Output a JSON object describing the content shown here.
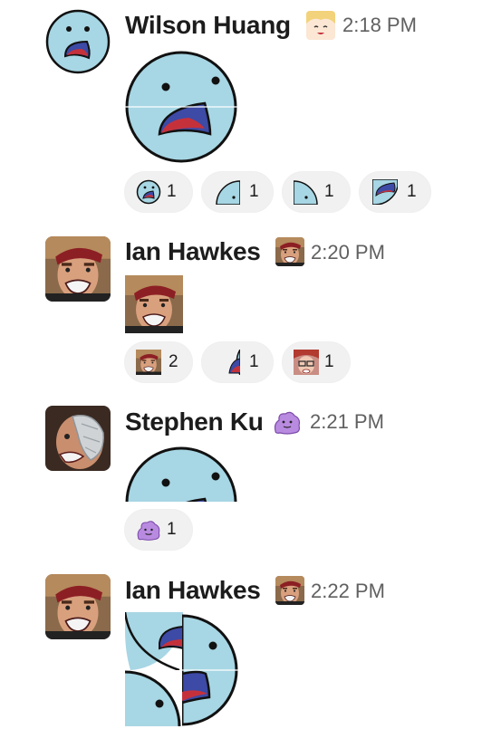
{
  "colors": {
    "face_blue": "#a7d6e4",
    "mouth_navy": "#3d4aa6",
    "tongue_red": "#c5313b",
    "reaction_bg": "#f1f1f1",
    "time_gray": "#616061"
  },
  "messages": [
    {
      "author": "Wilson Huang",
      "badge_icon": "anime-girl-emoji",
      "time": "2:18 PM",
      "attachment": "screaming-blue-face-emoji",
      "reactions": [
        {
          "emoji": "blue-face-emoji",
          "count": "1"
        },
        {
          "emoji": "blue-face-piece-top-left-emoji",
          "count": "1"
        },
        {
          "emoji": "blue-face-piece-top-right-emoji",
          "count": "1"
        },
        {
          "emoji": "blue-face-piece-mouth-emoji",
          "count": "1"
        }
      ]
    },
    {
      "author": "Ian Hawkes",
      "badge_icon": "angry-man-emoji",
      "time": "2:20 PM",
      "attachment": "angry-man-emoji",
      "reactions": [
        {
          "emoji": "angry-man-emoji",
          "count": "2"
        },
        {
          "emoji": "blue-face-mouth-piece-emoji",
          "count": "1"
        },
        {
          "emoji": "red-hair-glasses-face-emoji",
          "count": "1"
        }
      ]
    },
    {
      "author": "Stephen Ku",
      "badge_icon": "purple-blob-emoji",
      "time": "2:21 PM",
      "attachment": "blue-face-top-half-emoji",
      "reactions": [
        {
          "emoji": "purple-blob-emoji",
          "count": "1"
        }
      ]
    },
    {
      "author": "Ian Hawkes",
      "badge_icon": "angry-man-emoji",
      "time": "2:22 PM",
      "attachment": "scattered-blue-face-pieces-emoji",
      "reactions": []
    }
  ]
}
